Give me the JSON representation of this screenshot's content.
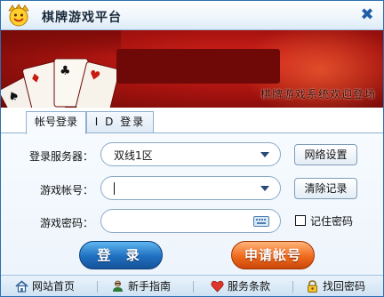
{
  "window": {
    "title": "棋牌游戏平台",
    "close_label": "✖"
  },
  "banner": {
    "caption": "棋牌游戏系统欢迎登场"
  },
  "tabs": [
    {
      "label": "帐号登录",
      "active": true
    },
    {
      "label": "I D 登录",
      "active": false
    }
  ],
  "form": {
    "server_label": "登录服务器：",
    "server_value": "双线1区",
    "network_button": "网络设置",
    "account_label": "游戏帐号：",
    "account_value": "",
    "clear_button": "清除记录",
    "password_label": "游戏密码：",
    "password_value": "",
    "remember_label": "记住密码",
    "remember_checked": false
  },
  "actions": {
    "login": "登 录",
    "register": "申请帐号"
  },
  "footer": {
    "links": [
      {
        "label": "网站首页",
        "icon": "home-icon"
      },
      {
        "label": "新手指南",
        "icon": "guide-icon"
      },
      {
        "label": "服务条款",
        "icon": "heart-icon"
      },
      {
        "label": "找回密码",
        "icon": "lock-icon"
      }
    ]
  },
  "colors": {
    "accent_blue": "#1f6fc0",
    "accent_orange": "#f06a1c",
    "banner_red": "#c01a14"
  }
}
